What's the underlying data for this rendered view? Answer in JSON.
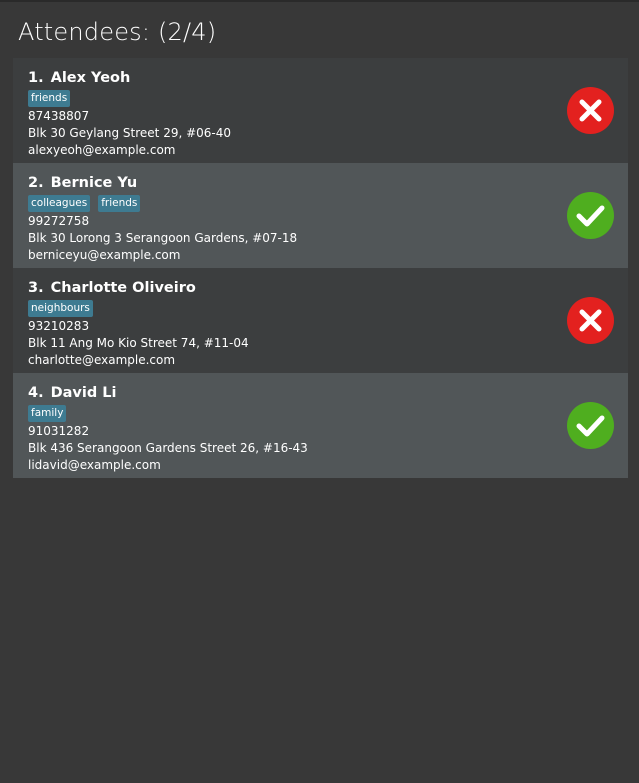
{
  "header": {
    "title": "Attendees: (2/4)"
  },
  "colors": {
    "present": "#4fae1f",
    "absent": "#e3211f",
    "tag": "#3e7b91"
  },
  "attendees": [
    {
      "index": "1.",
      "name": "Alex Yeoh",
      "tags": [
        "friends"
      ],
      "phone": "87438807",
      "address": "Blk 30 Geylang Street 29, #06-40",
      "email": "alexyeoh@example.com",
      "status_icon": "cross-icon"
    },
    {
      "index": "2.",
      "name": "Bernice Yu",
      "tags": [
        "colleagues",
        "friends"
      ],
      "phone": "99272758",
      "address": "Blk 30 Lorong 3 Serangoon Gardens, #07-18",
      "email": "berniceyu@example.com",
      "status_icon": "check-icon"
    },
    {
      "index": "3.",
      "name": "Charlotte Oliveiro",
      "tags": [
        "neighbours"
      ],
      "phone": "93210283",
      "address": "Blk 11 Ang Mo Kio Street 74, #11-04",
      "email": "charlotte@example.com",
      "status_icon": "cross-icon"
    },
    {
      "index": "4.",
      "name": "David Li",
      "tags": [
        "family"
      ],
      "phone": "91031282",
      "address": "Blk 436 Serangoon Gardens Street 26, #16-43",
      "email": "lidavid@example.com",
      "status_icon": "check-icon"
    }
  ]
}
